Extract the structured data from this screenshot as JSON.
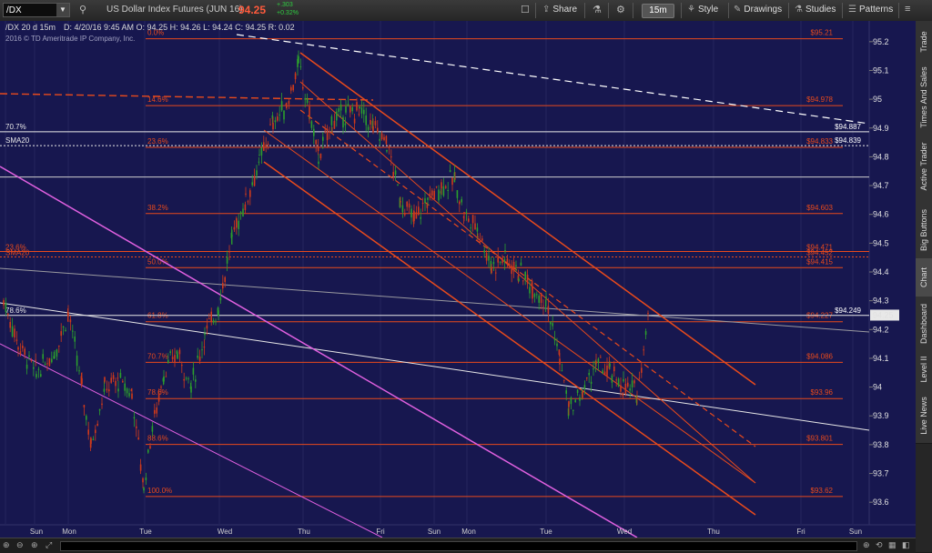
{
  "toolbar": {
    "symbol": "/DX",
    "instrument": "US Dollar Index Futures (JUN 16)",
    "last_price": "94.25",
    "change": "+.303",
    "change_pct": "+0.32%",
    "share_label": "Share",
    "timeframe": "15m",
    "style_label": "Style",
    "drawings_label": "Drawings",
    "studies_label": "Studies",
    "patterns_label": "Patterns"
  },
  "chart_header": {
    "title": "/DX 20 d 15m",
    "ohlc": "D: 4/20/16 9:45 AM   O: 94.25   H: 94.26   L: 94.24   C: 94.25   R: 0.02",
    "copyright": "2016 © TD Ameritrade IP Company, Inc."
  },
  "chart_data": {
    "type": "candlestick",
    "x_tick_labels": [
      "Sun",
      "Mon",
      "Tue",
      "Wed",
      "Thu",
      "Fri",
      "Sun",
      "Mon",
      "Tue",
      "Wed",
      "Thu",
      "Fri",
      "Sun"
    ],
    "y_tick_labels": [
      "95.2",
      "95.1",
      "95",
      "94.9",
      "94.8",
      "94.7",
      "94.6",
      "94.5",
      "94.4",
      "94.3",
      "94.2",
      "94.1",
      "94",
      "93.9",
      "93.8",
      "93.7",
      "93.6"
    ],
    "ylim": [
      93.55,
      95.25
    ],
    "current_price_label": "94.25",
    "fib_levels": [
      {
        "pct": "0.0%",
        "price": "$95.21"
      },
      {
        "pct": "14.6%",
        "price": "$94.978"
      },
      {
        "pct": "23.6%",
        "price": "$94.833"
      },
      {
        "pct": "38.2%",
        "price": "$94.603"
      },
      {
        "pct": "50.0%",
        "price": "$94.415"
      },
      {
        "pct": "61.8%",
        "price": "$94.227"
      },
      {
        "pct": "70.7%",
        "price": "$94.086"
      },
      {
        "pct": "78.6%",
        "price": "$93.96"
      },
      {
        "pct": "88.6%",
        "price": "$93.801"
      },
      {
        "pct": "100.0%",
        "price": "$93.62"
      }
    ],
    "fib_levels_small": [
      {
        "pct": "23.6%",
        "price": "$94.471"
      },
      {
        "pct": "SMA20",
        "price": "$94.452"
      }
    ],
    "white_levels": [
      {
        "pct": "70.7%",
        "price": "$94.887"
      },
      {
        "pct": "SMA20",
        "price": "$94.839"
      },
      {
        "pct": "78.6%",
        "price": "$94.249"
      }
    ]
  },
  "right_tabs": [
    "Trade",
    "Times And Sales",
    "Active Trader",
    "Big Buttons",
    "Chart",
    "Dashboard",
    "Level II",
    "Live News"
  ],
  "colors": {
    "chart_bg": "#17174f",
    "fib": "#e84a1c",
    "candle_up": "#2ca02c",
    "candle_down": "#d03a1a",
    "magenta": "#e060e0",
    "white_line": "#e8e8e8"
  }
}
